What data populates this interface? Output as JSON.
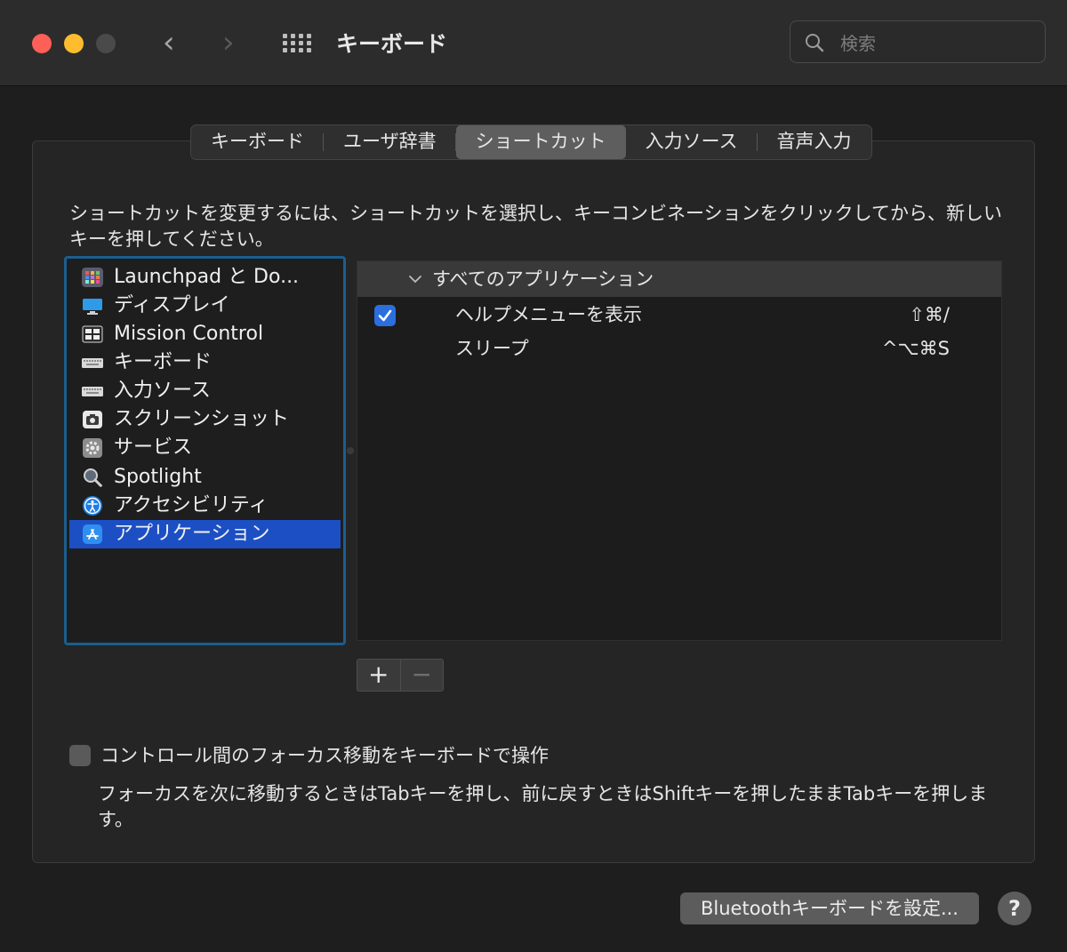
{
  "window": {
    "title": "キーボード"
  },
  "search": {
    "placeholder": "検索",
    "value": ""
  },
  "tabs": [
    {
      "label": "キーボード",
      "active": false
    },
    {
      "label": "ユーザ辞書",
      "active": false
    },
    {
      "label": "ショートカット",
      "active": true
    },
    {
      "label": "入力ソース",
      "active": false
    },
    {
      "label": "音声入力",
      "active": false
    }
  ],
  "instructions": "ショートカットを変更するには、ショートカットを選択し、キーコンビネーションをクリックしてから、新しいキーを押してください。",
  "categories": [
    {
      "label": "Launchpad と Do...",
      "icon": "launchpad-icon",
      "selected": false
    },
    {
      "label": "ディスプレイ",
      "icon": "display-icon",
      "selected": false
    },
    {
      "label": "Mission Control",
      "icon": "mission-control-icon",
      "selected": false
    },
    {
      "label": "キーボード",
      "icon": "keyboard-icon",
      "selected": false
    },
    {
      "label": "入力ソース",
      "icon": "input-source-icon",
      "selected": false
    },
    {
      "label": "スクリーンショット",
      "icon": "screenshot-icon",
      "selected": false
    },
    {
      "label": "サービス",
      "icon": "services-gear-icon",
      "selected": false
    },
    {
      "label": "Spotlight",
      "icon": "spotlight-magnifier-icon",
      "selected": false
    },
    {
      "label": "アクセシビリティ",
      "icon": "accessibility-icon",
      "selected": false
    },
    {
      "label": "アプリケーション",
      "icon": "app-store-icon",
      "selected": true
    }
  ],
  "shortcuts": {
    "group": "すべてのアプリケーション",
    "items": [
      {
        "name": "ヘルプメニューを表示",
        "key": "⇧⌘/",
        "enabled": true
      },
      {
        "name": "スリープ",
        "key": "^⌥⌘S",
        "enabled": false
      }
    ]
  },
  "buttons": {
    "add": "+",
    "remove": "−",
    "bluetooth": "Bluetoothキーボードを設定...",
    "help": "?"
  },
  "keyboard_nav": {
    "label": "コントロール間のフォーカス移動をキーボードで操作",
    "checked": false,
    "description": "フォーカスを次に移動するときはTabキーを押し、前に戻すときはShiftキーを押したままTabキーを押します。"
  },
  "colors": {
    "accent": "#1c4fc4",
    "checkbox": "#2b6fdf",
    "list_border": "#1b5e8e"
  }
}
